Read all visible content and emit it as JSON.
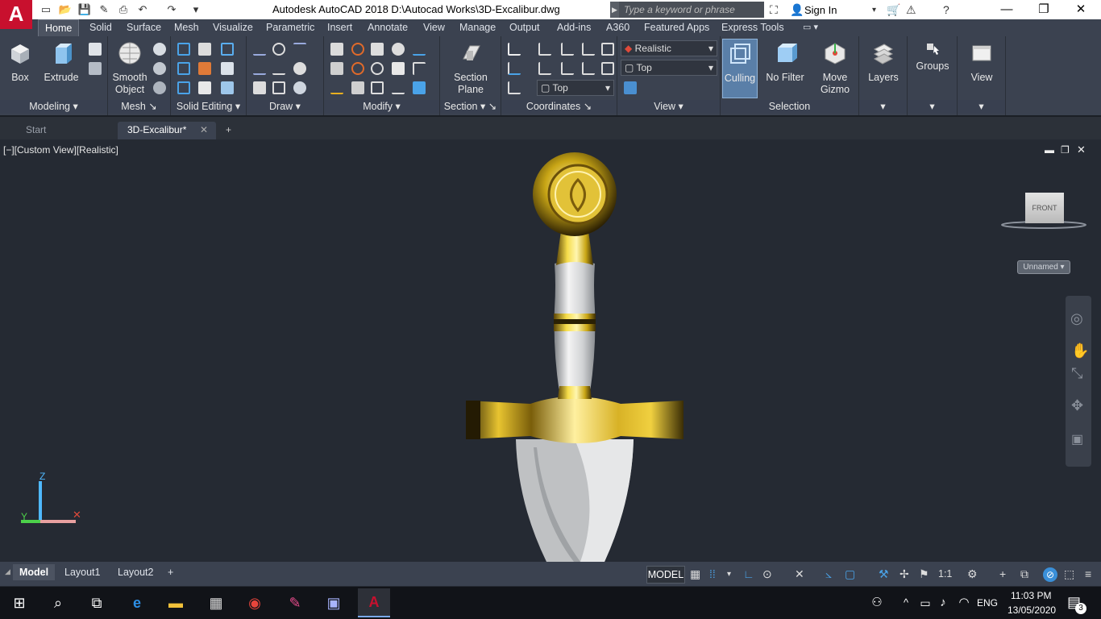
{
  "window": {
    "title": "Autodesk AutoCAD 2018    D:\\Autocad Works\\3D-Excalibur.dwg",
    "logo": "A"
  },
  "search": {
    "placeholder": "Type a keyword or phrase"
  },
  "signin": {
    "label": "Sign In"
  },
  "ribbon_tabs": [
    "Home",
    "Solid",
    "Surface",
    "Mesh",
    "Visualize",
    "Parametric",
    "Insert",
    "Annotate",
    "View",
    "Manage",
    "Output",
    "Add-ins",
    "A360",
    "Featured Apps",
    "Express Tools"
  ],
  "buttons": {
    "box": "Box",
    "extrude": "Extrude",
    "smooth_object": "Smooth\nObject",
    "section_plane": "Section\nPlane",
    "culling": "Culling",
    "no_filter": "No Filter",
    "move_gizmo": "Move\nGizmo",
    "layers": "Layers",
    "groups": "Groups",
    "view": "View"
  },
  "panels": {
    "modeling": "Modeling",
    "mesh": "Mesh",
    "solid_editing": "Solid Editing",
    "draw": "Draw",
    "modify": "Modify",
    "section": "Section",
    "coordinates": "Coordinates",
    "view": "View",
    "selection": "Selection"
  },
  "dropdowns": {
    "visual_style": "Realistic",
    "view_top": "Top",
    "ucs_top": "Top"
  },
  "file_tabs": {
    "start": "Start",
    "active": "3D-Excalibur*",
    "add": "+"
  },
  "viewport": {
    "label": "[−][Custom View][Realistic]",
    "viewcube_face": "FRONT",
    "ucs_name": "Unnamed"
  },
  "layout_tabs": [
    "Model",
    "Layout1",
    "Layout2"
  ],
  "status": {
    "model": "MODEL",
    "scale": "1:1"
  },
  "tray": {
    "lang": "ENG",
    "time": "11:03 PM",
    "date": "13/05/2020",
    "notifications": "3"
  },
  "colors": {
    "accent": "#3a8fd8",
    "gold": "#c9a616",
    "logo": "#c8102e"
  }
}
